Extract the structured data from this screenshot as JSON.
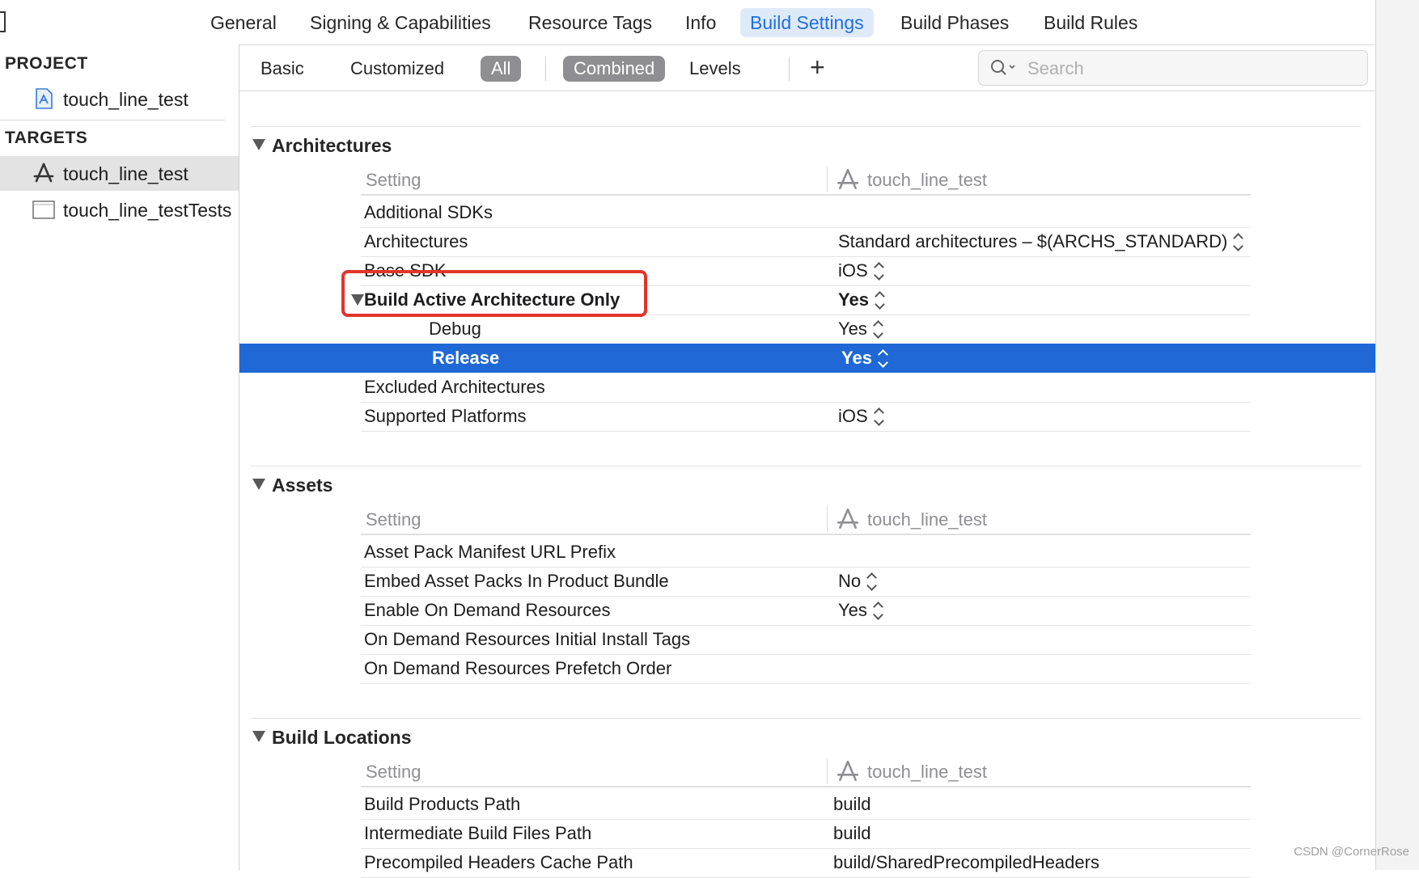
{
  "top_tabs": [
    "General",
    "Signing & Capabilities",
    "Resource Tags",
    "Info",
    "Build Settings",
    "Build Phases",
    "Build Rules"
  ],
  "sidebar": {
    "project_header": "PROJECT",
    "project_item": "touch_line_test",
    "targets_header": "TARGETS",
    "target_items": [
      "touch_line_test",
      "touch_line_testTests"
    ]
  },
  "filter": {
    "basic": "Basic",
    "customized": "Customized",
    "all": "All",
    "combined": "Combined",
    "levels": "Levels",
    "add": "+",
    "search_placeholder": "Search"
  },
  "sections": {
    "architectures": {
      "title": "Architectures",
      "col_setting": "Setting",
      "col_target": "touch_line_test",
      "rows": {
        "additional_sdks": {
          "label": "Additional SDKs",
          "value": ""
        },
        "architectures": {
          "label": "Architectures",
          "value": "Standard architectures  –  $(ARCHS_STANDARD)"
        },
        "base_sdk": {
          "label": "Base SDK",
          "value": "iOS"
        },
        "build_active": {
          "label": "Build Active Architecture Only",
          "value": "Yes"
        },
        "debug": {
          "label": "Debug",
          "value": "Yes"
        },
        "release": {
          "label": "Release",
          "value": "Yes"
        },
        "excluded": {
          "label": "Excluded Architectures",
          "value": ""
        },
        "supported": {
          "label": "Supported Platforms",
          "value": "iOS"
        }
      }
    },
    "assets": {
      "title": "Assets",
      "col_setting": "Setting",
      "col_target": "touch_line_test",
      "rows": {
        "manifest": {
          "label": "Asset Pack Manifest URL Prefix",
          "value": ""
        },
        "embed": {
          "label": "Embed Asset Packs In Product Bundle",
          "value": "No"
        },
        "on_demand": {
          "label": "Enable On Demand Resources",
          "value": "Yes"
        },
        "initial_tags": {
          "label": "On Demand Resources Initial Install Tags",
          "value": ""
        },
        "prefetch": {
          "label": "On Demand Resources Prefetch Order",
          "value": ""
        }
      }
    },
    "build_locations": {
      "title": "Build Locations",
      "col_setting": "Setting",
      "col_target": "touch_line_test",
      "rows": {
        "products": {
          "label": "Build Products Path",
          "value": "build"
        },
        "intermediate": {
          "label": "Intermediate Build Files Path",
          "value": "build"
        },
        "precompiled": {
          "label": "Precompiled Headers Cache Path",
          "value": "build/SharedPrecompiledHeaders"
        }
      }
    }
  },
  "watermark": "CSDN @CornerRose",
  "colors": {
    "accent": "#1f68d6",
    "highlight": "#e0352b",
    "pill": "#8e8e93"
  }
}
